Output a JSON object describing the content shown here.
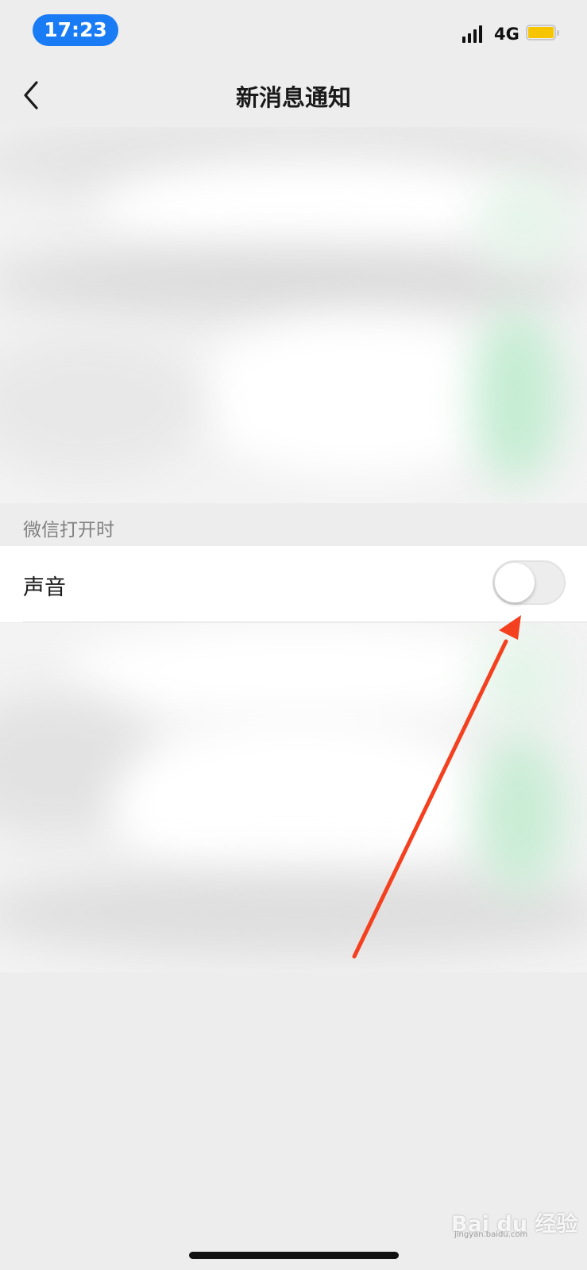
{
  "status_bar": {
    "time": "17:23",
    "network": "4G",
    "battery_color": "#f7c500"
  },
  "nav": {
    "title": "新消息通知",
    "back_icon": "chevron-left-icon"
  },
  "section": {
    "header": "微信打开时"
  },
  "settings": [
    {
      "label": "声音",
      "toggle_on": false
    }
  ],
  "annotation": {
    "arrow_color": "#f4401f"
  },
  "watermark": {
    "text": "Bai du 经验",
    "sub": "jingyan.baidu.com"
  }
}
